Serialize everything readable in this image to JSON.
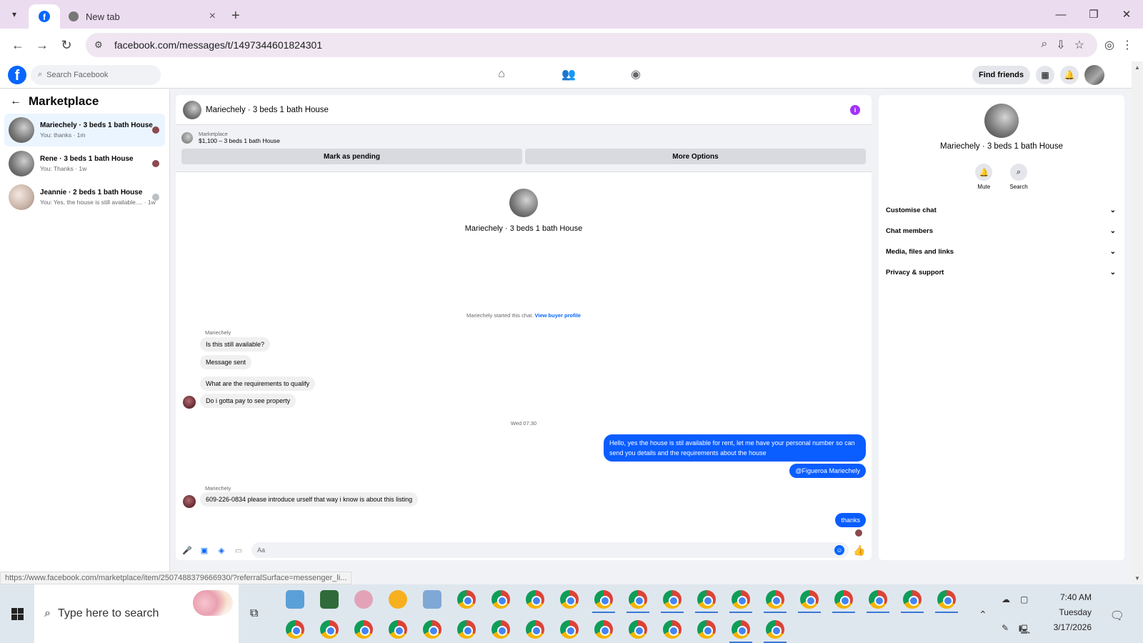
{
  "browser": {
    "tabs": [
      {
        "title": "",
        "icon": "facebook-icon",
        "active": true
      },
      {
        "title": "New tab",
        "icon": "chrome-icon",
        "active": false
      }
    ],
    "url": "facebook.com/messages/t/1497344601824301",
    "status_url": "https://www.facebook.com/marketplace/item/2507488379666930/?referralSurface=messenger_li..."
  },
  "fb_header": {
    "search_placeholder": "Search Facebook",
    "find_friends": "Find friends"
  },
  "sidebar": {
    "title": "Marketplace",
    "conversations": [
      {
        "name": "Mariechely · 3 beds 1 bath House",
        "preview": "You: thanks · 1m",
        "active": true
      },
      {
        "name": "Rene · 3 beds 1 bath House",
        "preview": "You: Thanks · 1w",
        "active": false
      },
      {
        "name": "Jeannie · 2 beds 1 bath House",
        "preview": "You: Yes, the house is still available.... · 1w",
        "active": false
      }
    ]
  },
  "chat": {
    "title": "Mariechely · 3 beds 1 bath House",
    "listing": {
      "category": "Marketplace",
      "price_title": "$1,100 – 3 beds 1 bath House",
      "mark_pending": "Mark as pending",
      "more_options": "More Options"
    },
    "profile_name": "Mariechely · 3 beds 1 bath House",
    "started_text": "Mariechely started this chat.",
    "view_buyer": "View buyer profile",
    "messages": {
      "sender1": "Mariechely",
      "m1": "Is this still available?",
      "m2": "Message sent",
      "m3": "What are the requirements to qualify",
      "m4": "Do i gotta pay to see property",
      "time_sep": "Wed 07:30",
      "out1": "Hello, yes the house is stil available for rent, let me have your personal number so can send you details and the requirements about the house",
      "out2": "@Figueroa Mariechely",
      "sender2": "Mariechely",
      "m5": "609-226-0834 please introduce urself that way i know is about this listing",
      "out3": "thanks"
    },
    "composer_placeholder": "Aa"
  },
  "right_panel": {
    "name": "Mariechely · 3 beds 1 bath House",
    "mute": "Mute",
    "search": "Search",
    "sections": [
      "Customise chat",
      "Chat members",
      "Media, files and links",
      "Privacy & support"
    ]
  },
  "taskbar": {
    "search_placeholder": "Type here to search",
    "time": "7:40 AM",
    "day": "Tuesday",
    "date": "3/17/2026"
  }
}
